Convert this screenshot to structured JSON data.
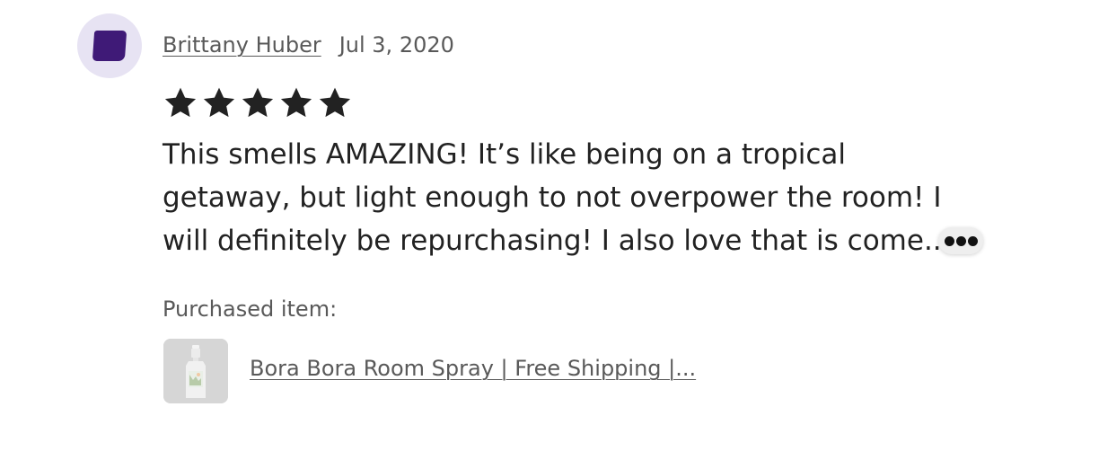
{
  "review": {
    "reviewer_name": "Brittany Huber",
    "date": "Jul 3, 2020",
    "rating": 5,
    "rating_max": 5,
    "text_lines": [
      "This smells AMAZING! It’s like being on a tropical",
      "getaway, but light enough to not overpower the room! I",
      "will definitely be repurchasing! I also love that is come..."
    ],
    "purchased_label": "Purchased item:",
    "item_title": "Bora Bora Room Spray | Free Shipping |...",
    "avatar_color": "#3f1a77",
    "avatar_bg": "#e7e3f3",
    "star_color": "#222222",
    "more_icon": "ellipsis-icon"
  }
}
